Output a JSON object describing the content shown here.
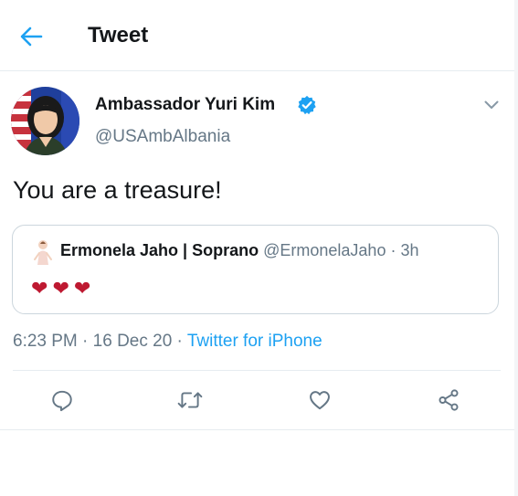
{
  "header": {
    "title": "Tweet",
    "back_icon": "arrow-left-icon"
  },
  "tweet": {
    "author_name": "Ambassador Yuri Kim",
    "author_handle": "@USAmbAlbania",
    "verified_icon": "verified-badge-icon",
    "text": "You are a treasure!",
    "time": "6:23 PM",
    "date": "16 Dec 20",
    "separator": " · ",
    "source": "Twitter for iPhone"
  },
  "quote": {
    "name": "Ermonela Jaho | Soprano",
    "handle": "@ErmonelaJaho",
    "age": "3h",
    "separator": " · ",
    "body": [
      "❤",
      "❤",
      "❤"
    ]
  },
  "actions": {
    "reply_icon": "reply-icon",
    "retweet_icon": "retweet-icon",
    "like_icon": "heart-icon",
    "share_icon": "share-icon"
  },
  "colors": {
    "accent": "#1da1f2",
    "secondary_text": "#657786",
    "border": "#e6ecf0",
    "heart_red": "#be1931"
  }
}
